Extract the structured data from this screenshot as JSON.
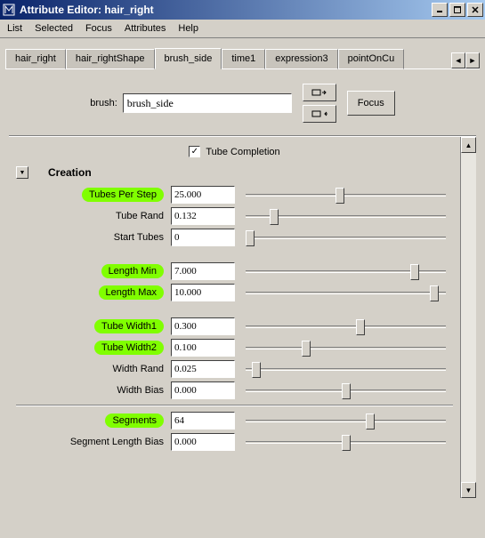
{
  "window": {
    "title": "Attribute Editor: hair_right"
  },
  "menu": {
    "list": "List",
    "selected": "Selected",
    "focus": "Focus",
    "attributes": "Attributes",
    "help": "Help"
  },
  "tabs": {
    "items": [
      {
        "label": "hair_right"
      },
      {
        "label": "hair_rightShape"
      },
      {
        "label": "brush_side"
      },
      {
        "label": "time1"
      },
      {
        "label": "expression3"
      },
      {
        "label": "pointOnCu"
      }
    ],
    "active_index": 2
  },
  "brush": {
    "label": "brush:",
    "value": "brush_side",
    "focus_label": "Focus"
  },
  "tube_completion": {
    "label": "Tube Completion",
    "checked": true
  },
  "creation": {
    "title": "Creation",
    "fields": {
      "tubes_per_step": {
        "label": "Tubes Per Step",
        "value": "25.000",
        "hl": true,
        "pos": 45
      },
      "tube_rand": {
        "label": "Tube Rand",
        "value": "0.132",
        "hl": false,
        "pos": 12
      },
      "start_tubes": {
        "label": "Start Tubes",
        "value": "0",
        "hl": false,
        "pos": 0
      },
      "length_min": {
        "label": "Length Min",
        "value": "7.000",
        "hl": true,
        "pos": 82
      },
      "length_max": {
        "label": "Length Max",
        "value": "10.000",
        "hl": true,
        "pos": 92
      },
      "tube_width1": {
        "label": "Tube Width1",
        "value": "0.300",
        "hl": true,
        "pos": 55
      },
      "tube_width2": {
        "label": "Tube Width2",
        "value": "0.100",
        "hl": true,
        "pos": 28
      },
      "width_rand": {
        "label": "Width Rand",
        "value": "0.025",
        "hl": false,
        "pos": 3
      },
      "width_bias": {
        "label": "Width Bias",
        "value": "0.000",
        "hl": false,
        "pos": 48
      },
      "segments": {
        "label": "Segments",
        "value": "64",
        "hl": true,
        "pos": 60
      },
      "seg_len_bias": {
        "label": "Segment Length Bias",
        "value": "0.000",
        "hl": false,
        "pos": 48
      }
    }
  }
}
